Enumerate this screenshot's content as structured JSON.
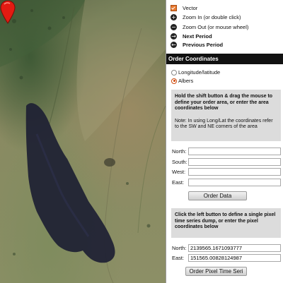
{
  "layers": [
    {
      "icon": "checkbox-checked-icon",
      "label": "Vector",
      "bold": false
    },
    {
      "icon": "zoom-in-icon",
      "glyph": "+",
      "label": "Zoom In (or double click)",
      "bold": false
    },
    {
      "icon": "zoom-out-icon",
      "glyph": "−",
      "label": "Zoom Out (or mouse wheel)",
      "bold": false
    },
    {
      "icon": "next-arrow-icon",
      "glyph": "→",
      "label": "Next Period",
      "bold": true
    },
    {
      "icon": "previous-arrow-icon",
      "glyph": "←",
      "label": "Previous Period",
      "bold": true
    }
  ],
  "order_coordinates": {
    "title": "Order Coordinates",
    "radio_options": [
      {
        "label": "Longitude/latitude",
        "selected": false
      },
      {
        "label": "Albers",
        "selected": true
      }
    ],
    "instructions_bold": "Hold the shift button & drag the mouse to define your order area, or enter the area coordinates below",
    "instructions_note": "Note: In using Long/Lat the coordinates refer to the SW and NE corners of the area",
    "fields": [
      {
        "label": "North:",
        "value": ""
      },
      {
        "label": "South:",
        "value": ""
      },
      {
        "label": "West:",
        "value": ""
      },
      {
        "label": "East:",
        "value": ""
      }
    ],
    "order_button": "Order Data"
  },
  "pixel_dump": {
    "instructions": "Click the left button to define a single pixel time series dump, or enter the pixel coordinates below",
    "fields": [
      {
        "label": "North:",
        "value": "2139565.1671093777"
      },
      {
        "label": "East:",
        "value": "151565.00828124987"
      }
    ],
    "order_button": "Order Pixel Time Seri"
  },
  "colors": {
    "accent": "#e8792f",
    "header_bg": "#111111",
    "info_box_bg": "#dcdcdc",
    "marker": "#e21b12"
  }
}
